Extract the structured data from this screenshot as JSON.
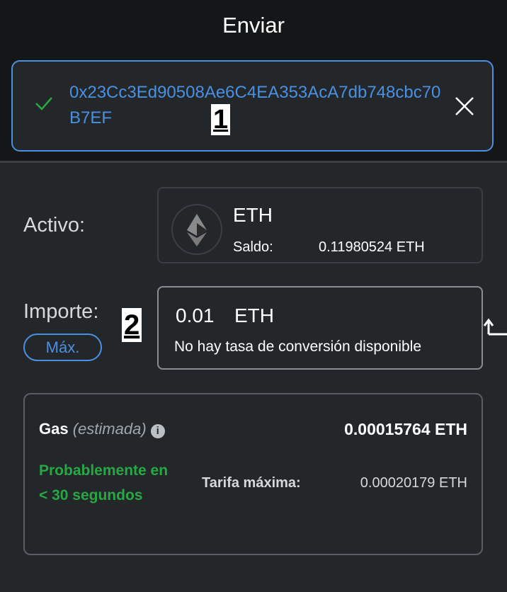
{
  "header": {
    "title": "Enviar"
  },
  "recipient": {
    "address": "0x23Cc3Ed90508Ae6C4EA353AcA7db748cbc70B7EF",
    "marker": "1"
  },
  "asset": {
    "label": "Activo:",
    "symbol": "ETH",
    "balance_label": "Saldo:",
    "balance": "0.11980524 ETH"
  },
  "amount": {
    "label": "Importe:",
    "max_label": "Máx.",
    "value": "0.01",
    "unit": "ETH",
    "conversion": "No hay tasa de conversión disponible",
    "marker": "2"
  },
  "gas": {
    "label": "Gas",
    "estimated": "(estimada)",
    "value": "0.00015764 ETH",
    "speed": "Probablemente en",
    "speed2": "< 30 segundos",
    "max_fee_label": "Tarifa máxima:",
    "max_fee": "0.00020179 ETH"
  },
  "colors": {
    "accent": "#4a90e2",
    "success": "#28a745"
  }
}
